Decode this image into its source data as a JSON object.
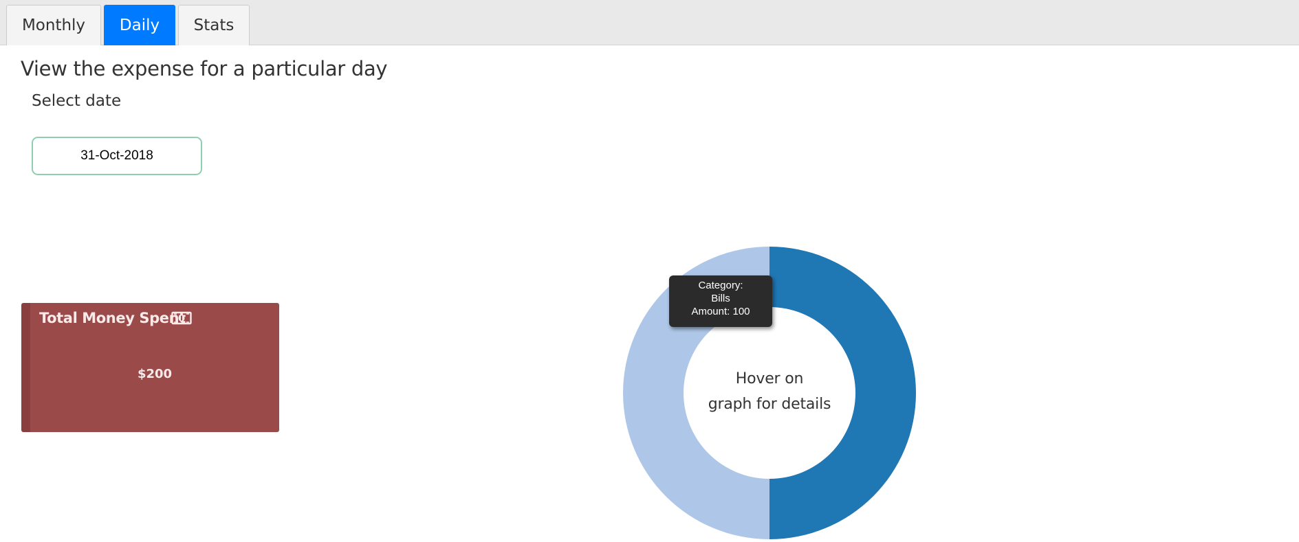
{
  "tabs": {
    "monthly": "Monthly",
    "daily": "Daily",
    "stats": "Stats",
    "active": "Daily"
  },
  "page": {
    "heading": "View the expense for a particular day",
    "date_label": "Select date",
    "date_value": "31-Oct-2018"
  },
  "summary": {
    "title": "Total Money Spent",
    "icon": "money-bill-icon",
    "amount": "$200"
  },
  "chart": {
    "center_line1": "Hover on",
    "center_line2": "graph for details",
    "tooltip": {
      "category_label": "Category:",
      "category_value": "Bills",
      "amount_text": "Amount: 100"
    }
  },
  "colors": {
    "tab_active": "#007bff",
    "card_bg": "#994a49",
    "slice_dark": "#1f77b4",
    "slice_light": "#aec7e8",
    "input_border": "#8fcfb0"
  },
  "chart_data": {
    "type": "pie",
    "donut": true,
    "categories": [
      "",
      "Bills"
    ],
    "values": [
      100,
      100
    ],
    "colors": [
      "#1f77b4",
      "#aec7e8"
    ]
  }
}
